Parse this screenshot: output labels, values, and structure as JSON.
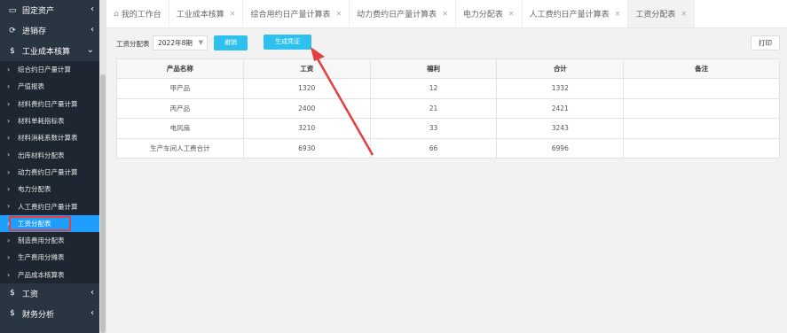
{
  "sidebar": {
    "top": [
      {
        "label": "固定资产",
        "icon": "monitor-icon"
      },
      {
        "label": "进销存",
        "icon": "loop-icon"
      },
      {
        "label": "工业成本核算",
        "icon": "dollar-icon"
      }
    ],
    "sub": [
      "综合约日产量计算",
      "产值报表",
      "材料费约日产量计算",
      "材料单耗指标表",
      "材料消耗系数计算表",
      "出库材料分配表",
      "动力费约日产量计算",
      "电力分配表",
      "人工费约日产量计算",
      "工资分配表",
      "制造费用分配表",
      "生产费用分摊表",
      "产品成本核算表"
    ],
    "bottom": [
      {
        "label": "工资",
        "icon": "dollar-icon"
      },
      {
        "label": "财务分析",
        "icon": "dollar-icon"
      }
    ]
  },
  "tabs": [
    "我的工作台",
    "工业成本核算",
    "综合用约日产量计算表",
    "动力费约日产量计算表",
    "电力分配表",
    "人工费约日产量计算表",
    "工资分配表"
  ],
  "toolbar": {
    "label": "工资分配表",
    "period": "2022年8期",
    "cancel": "撤销",
    "generate": "生成凭证",
    "print": "打印"
  },
  "table": {
    "headers": [
      "产品名称",
      "工资",
      "福利",
      "合计",
      "备注"
    ],
    "rows": [
      [
        "甲产品",
        "1320",
        "12",
        "1332",
        ""
      ],
      [
        "丙产品",
        "2400",
        "21",
        "2421",
        ""
      ],
      [
        "电风扇",
        "3210",
        "33",
        "3243",
        ""
      ],
      [
        "生产车间人工费合计",
        "6930",
        "66",
        "6996",
        ""
      ]
    ]
  },
  "colors": {
    "accent": "#1e9fff",
    "button": "#2ec1f0",
    "sidebar": "#2a3542",
    "arrow": "#e53e3e"
  }
}
